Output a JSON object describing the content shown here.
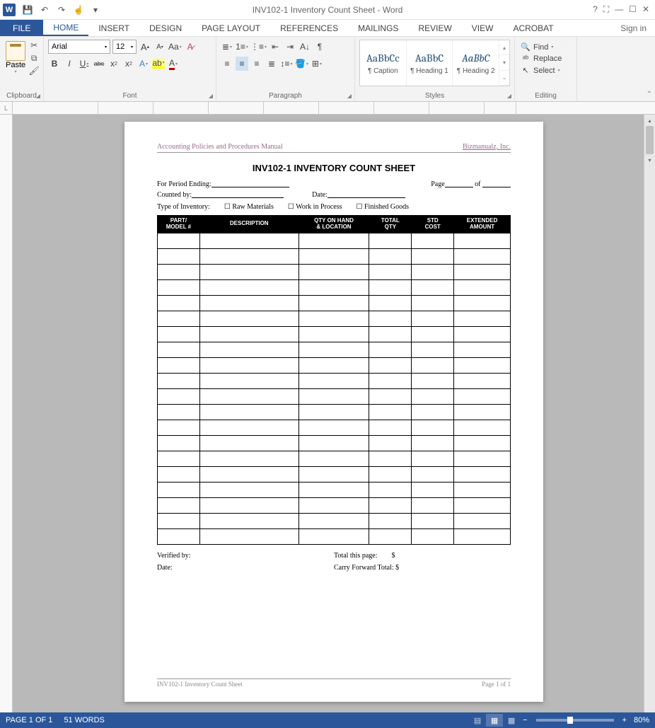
{
  "window": {
    "title": "INV102-1 Inventory Count Sheet - Word",
    "signin": "Sign in"
  },
  "qat": {
    "save": "save",
    "undo": "undo",
    "redo": "redo",
    "customize": "customize"
  },
  "tabs": {
    "file": "FILE",
    "items": [
      "HOME",
      "INSERT",
      "DESIGN",
      "PAGE LAYOUT",
      "REFERENCES",
      "MAILINGS",
      "REVIEW",
      "VIEW",
      "ACROBAT"
    ],
    "active": "HOME"
  },
  "ribbon": {
    "clipboard": {
      "label": "Clipboard",
      "paste": "Paste"
    },
    "font": {
      "label": "Font",
      "name": "Arial",
      "size": "12",
      "bold": "B",
      "italic": "I",
      "underline": "U",
      "strike": "abc",
      "sub": "x₂",
      "sup": "x²",
      "caseBtn": "Aa",
      "clear": "A",
      "grow": "A",
      "shrink": "A"
    },
    "paragraph": {
      "label": "Paragraph"
    },
    "styles": {
      "label": "Styles",
      "items": [
        {
          "preview": "AaBbCc",
          "name": "¶ Caption"
        },
        {
          "preview": "AaBbC",
          "name": "¶ Heading 1"
        },
        {
          "preview": "AaBbC",
          "name": "¶ Heading 2"
        }
      ]
    },
    "editing": {
      "label": "Editing",
      "find": "Find",
      "replace": "Replace",
      "select": "Select"
    }
  },
  "document": {
    "header_left": "Accounting Policies and Procedures Manual",
    "header_right": "Bizmanualz, Inc.",
    "title": "INV102-1 INVENTORY COUNT SHEET",
    "period_label": "For Period Ending:",
    "page_label": "Page",
    "of_label": "of",
    "counted_label": "Counted by:",
    "date_label": "Date:",
    "type_label": "Type of Inventory:",
    "type_raw": "Raw Materials",
    "type_wip": "Work in Process",
    "type_fg": "Finished Goods",
    "columns": [
      "PART/\nMODEL #",
      "DESCRIPTION",
      "QTY ON HAND\n& LOCATION",
      "TOTAL\nQTY",
      "STD\nCOST",
      "EXTENDED\nAMOUNT"
    ],
    "blank_rows": 20,
    "verified_label": "Verified by:",
    "date2_label": "Date:",
    "total_label": "Total this page:",
    "carry_label": "Carry Forward Total:",
    "dollar": "$",
    "footer_left": "INV102-1 Inventory Count Sheet",
    "footer_right": "Page 1 of 1"
  },
  "status": {
    "page": "PAGE 1 OF 1",
    "words": "51 WORDS",
    "zoom": "80%"
  }
}
